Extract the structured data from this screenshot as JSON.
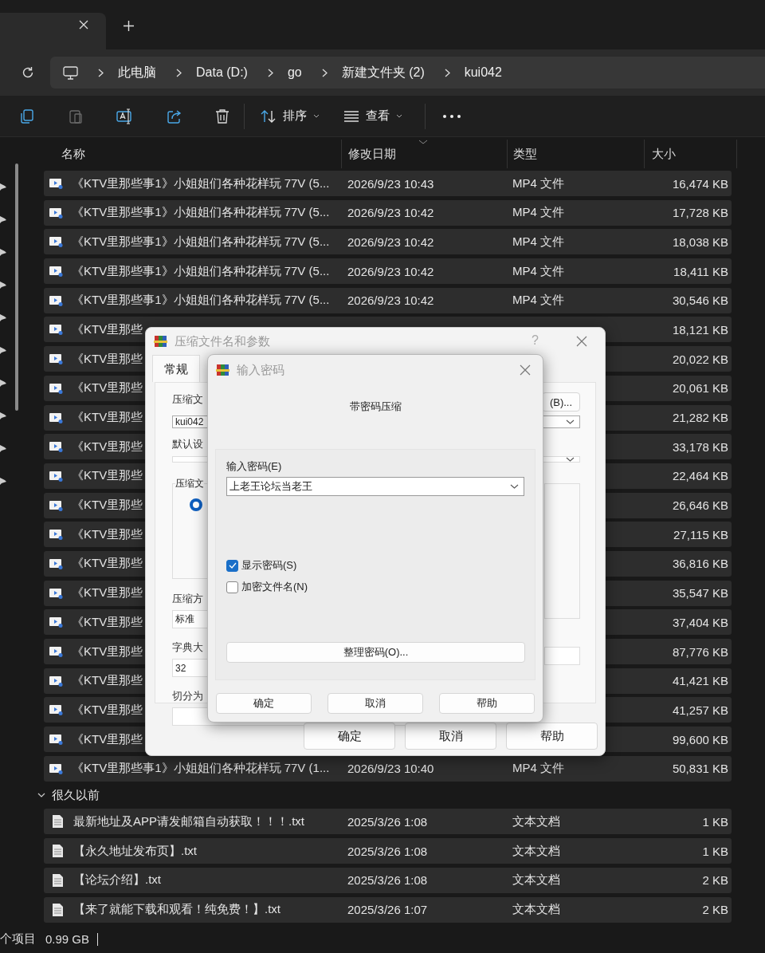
{
  "breadcrumb": [
    "此电脑",
    "Data (D:)",
    "go",
    "新建文件夹 (2)",
    "kui042"
  ],
  "toolbar": {
    "sort": "排序",
    "view": "查看"
  },
  "columns": [
    "名称",
    "修改日期",
    "类型",
    "大小"
  ],
  "files": [
    {
      "kind": "video",
      "name": "《KTV里那些事1》小姐姐们各种花样玩 77V (5...",
      "date": "2026/9/23 10:43",
      "type": "MP4 文件",
      "size": "16,474 KB",
      "selected": true
    },
    {
      "kind": "video",
      "name": "《KTV里那些事1》小姐姐们各种花样玩 77V (5...",
      "date": "2026/9/23 10:42",
      "type": "MP4 文件",
      "size": "17,728 KB",
      "selected": true
    },
    {
      "kind": "video",
      "name": "《KTV里那些事1》小姐姐们各种花样玩 77V (5...",
      "date": "2026/9/23 10:42",
      "type": "MP4 文件",
      "size": "18,038 KB",
      "selected": true
    },
    {
      "kind": "video",
      "name": "《KTV里那些事1》小姐姐们各种花样玩 77V (5...",
      "date": "2026/9/23 10:42",
      "type": "MP4 文件",
      "size": "18,411 KB",
      "selected": true
    },
    {
      "kind": "video",
      "name": "《KTV里那些事1》小姐姐们各种花样玩 77V (5...",
      "date": "2026/9/23 10:42",
      "type": "MP4 文件",
      "size": "30,546 KB",
      "selected": true
    },
    {
      "kind": "video",
      "name": "《KTV里那些",
      "size": "18,121 KB",
      "selected": true
    },
    {
      "kind": "video",
      "name": "《KTV里那些",
      "size": "20,022 KB",
      "selected": true
    },
    {
      "kind": "video",
      "name": "《KTV里那些",
      "size": "20,061 KB",
      "selected": true
    },
    {
      "kind": "video",
      "name": "《KTV里那些",
      "size": "21,282 KB",
      "selected": true
    },
    {
      "kind": "video",
      "name": "《KTV里那些",
      "size": "33,178 KB",
      "selected": true
    },
    {
      "kind": "video",
      "name": "《KTV里那些",
      "size": "22,464 KB",
      "selected": true
    },
    {
      "kind": "video",
      "name": "《KTV里那些",
      "size": "26,646 KB",
      "selected": true
    },
    {
      "kind": "video",
      "name": "《KTV里那些",
      "size": "27,115 KB",
      "selected": true
    },
    {
      "kind": "video",
      "name": "《KTV里那些",
      "size": "36,816 KB",
      "selected": true
    },
    {
      "kind": "video",
      "name": "《KTV里那些",
      "size": "35,547 KB",
      "selected": true
    },
    {
      "kind": "video",
      "name": "《KTV里那些",
      "size": "37,404 KB",
      "selected": true
    },
    {
      "kind": "video",
      "name": "《KTV里那些",
      "size": "87,776 KB",
      "selected": true
    },
    {
      "kind": "video",
      "name": "《KTV里那些",
      "size": "41,421 KB",
      "selected": true
    },
    {
      "kind": "video",
      "name": "《KTV里那些",
      "size": "41,257 KB",
      "selected": true
    },
    {
      "kind": "video",
      "name": "《KTV里那些",
      "size": "99,600 KB",
      "selected": true
    },
    {
      "kind": "video",
      "name": "《KTV里那些事1》小姐姐们各种花样玩 77V (1...",
      "date": "2026/9/23 10:40",
      "type": "MP4 文件",
      "size": "50,831 KB",
      "selected": true
    }
  ],
  "groups": [
    {
      "label": "很久以前",
      "expanded": true,
      "rows": [
        {
          "kind": "text",
          "name": "最新地址及APP请发邮箱自动获取！！！.txt",
          "date": "2025/3/26 1:08",
          "type": "文本文档",
          "size": "1 KB",
          "selected": true
        },
        {
          "kind": "text",
          "name": "【永久地址发布页】.txt",
          "date": "2025/3/26 1:08",
          "type": "文本文档",
          "size": "1 KB",
          "selected": true
        },
        {
          "kind": "text",
          "name": "【论坛介绍】.txt",
          "date": "2025/3/26 1:08",
          "type": "文本文档",
          "size": "2 KB",
          "selected": true
        },
        {
          "kind": "text",
          "name": "【来了就能下载和观看！纯免费！】.txt",
          "date": "2025/3/26 1:07",
          "type": "文本文档",
          "size": "2 KB",
          "selected": true
        }
      ]
    }
  ],
  "status_bar": {
    "items": "个项目",
    "size": "0.99 GB"
  },
  "archive_dialog": {
    "title": "压缩文件名和参数",
    "help": "?",
    "tabs": [
      {
        "label": "常规",
        "selected": true
      }
    ],
    "name_label": "压缩文",
    "browse_button": "(B)...",
    "archive_name": "kui042",
    "profile_label": "默认设",
    "format_label": "压缩文",
    "format_option": {
      "selected": true
    },
    "method_label": "压缩方",
    "method": "标准",
    "dictionary_label": "字典大",
    "dictionary": "32",
    "split_label": "切分为",
    "buttons": [
      "确定",
      "取消",
      "帮助"
    ]
  },
  "password_dialog": {
    "title": "输入密码",
    "heading": "带密码压缩",
    "password_label": "输入密码(E)",
    "password": "上老王论坛当老王",
    "options": [
      {
        "label": "显示密码(S)",
        "checked": true
      },
      {
        "label": "加密文件名(N)",
        "checked": false
      }
    ],
    "organize_button": "整理密码(O)...",
    "buttons": [
      "确定",
      "取消",
      "帮助"
    ]
  }
}
